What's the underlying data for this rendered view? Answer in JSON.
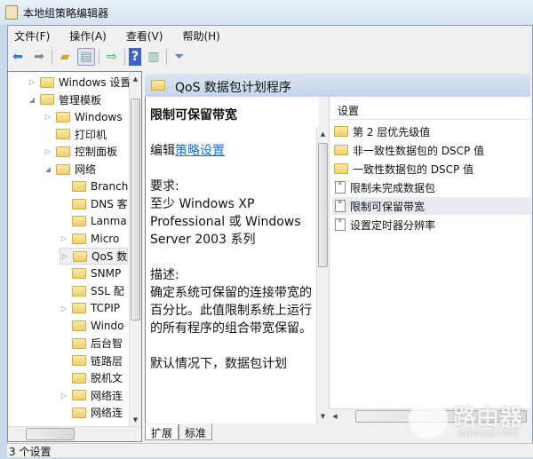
{
  "window": {
    "title": "本地组策略编辑器"
  },
  "menu": [
    "文件(F)",
    "操作(A)",
    "查看(V)",
    "帮助(H)"
  ],
  "toolbar": [
    "back-icon",
    "forward-icon",
    "up-folder-icon",
    "show-hide-tree-icon",
    "export-icon",
    "help-icon",
    "properties-icon",
    "filter-icon"
  ],
  "tree": [
    {
      "label": "Windows 设置",
      "level": 1,
      "arrow": "collapsed"
    },
    {
      "label": "管理模板",
      "level": 1,
      "arrow": "expanded"
    },
    {
      "label": "Windows",
      "level": 2,
      "arrow": "collapsed"
    },
    {
      "label": "打印机",
      "level": 2,
      "arrow": ""
    },
    {
      "label": "控制面板",
      "level": 2,
      "arrow": "collapsed"
    },
    {
      "label": "网络",
      "level": 2,
      "arrow": "expanded"
    },
    {
      "label": "Branch",
      "level": 3,
      "arrow": ""
    },
    {
      "label": "DNS 客",
      "level": 3,
      "arrow": ""
    },
    {
      "label": "Lanma",
      "level": 3,
      "arrow": ""
    },
    {
      "label": "Micro",
      "level": 3,
      "arrow": "collapsed"
    },
    {
      "label": "QoS 数",
      "level": 3,
      "arrow": "collapsed",
      "selected": true
    },
    {
      "label": "SNMP",
      "level": 3,
      "arrow": ""
    },
    {
      "label": "SSL 配",
      "level": 3,
      "arrow": ""
    },
    {
      "label": "TCPIP",
      "level": 3,
      "arrow": "collapsed"
    },
    {
      "label": "Windo",
      "level": 3,
      "arrow": ""
    },
    {
      "label": "后台智",
      "level": 3,
      "arrow": ""
    },
    {
      "label": "链路层",
      "level": 3,
      "arrow": ""
    },
    {
      "label": "脱机文",
      "level": 3,
      "arrow": ""
    },
    {
      "label": "网络连",
      "level": 3,
      "arrow": "collapsed"
    },
    {
      "label": "网络连",
      "level": 3,
      "arrow": ""
    }
  ],
  "header": {
    "title": "QoS 数据包计划程序"
  },
  "description": {
    "title": "限制可保留带宽",
    "edit_prefix": "编辑",
    "edit_link": "策略设置",
    "req_label": "要求:",
    "req_text": "至少 Windows XP Professional 或 Windows Server 2003 系列",
    "desc_label": "描述:",
    "desc_text": "确定系统可保留的连接带宽的百分比。此值限制系统上运行的所有程序的组合带宽保留。",
    "more_text": "默认情况下，数据包计划"
  },
  "list": {
    "column": "设置",
    "items": [
      {
        "label": "第 2 层优先级值",
        "type": "folder"
      },
      {
        "label": "非一致性数据包的 DSCP 值",
        "type": "folder"
      },
      {
        "label": "一致性数据包的 DSCP 值",
        "type": "folder"
      },
      {
        "label": "限制未完成数据包",
        "type": "setting"
      },
      {
        "label": "限制可保留带宽",
        "type": "setting",
        "selected": true
      },
      {
        "label": "设置定时器分辨率",
        "type": "setting"
      }
    ]
  },
  "tabs": [
    "扩展",
    "标准"
  ],
  "status": "3 个设置",
  "watermark": {
    "name": "路由器",
    "url": "luyouqi.com"
  }
}
